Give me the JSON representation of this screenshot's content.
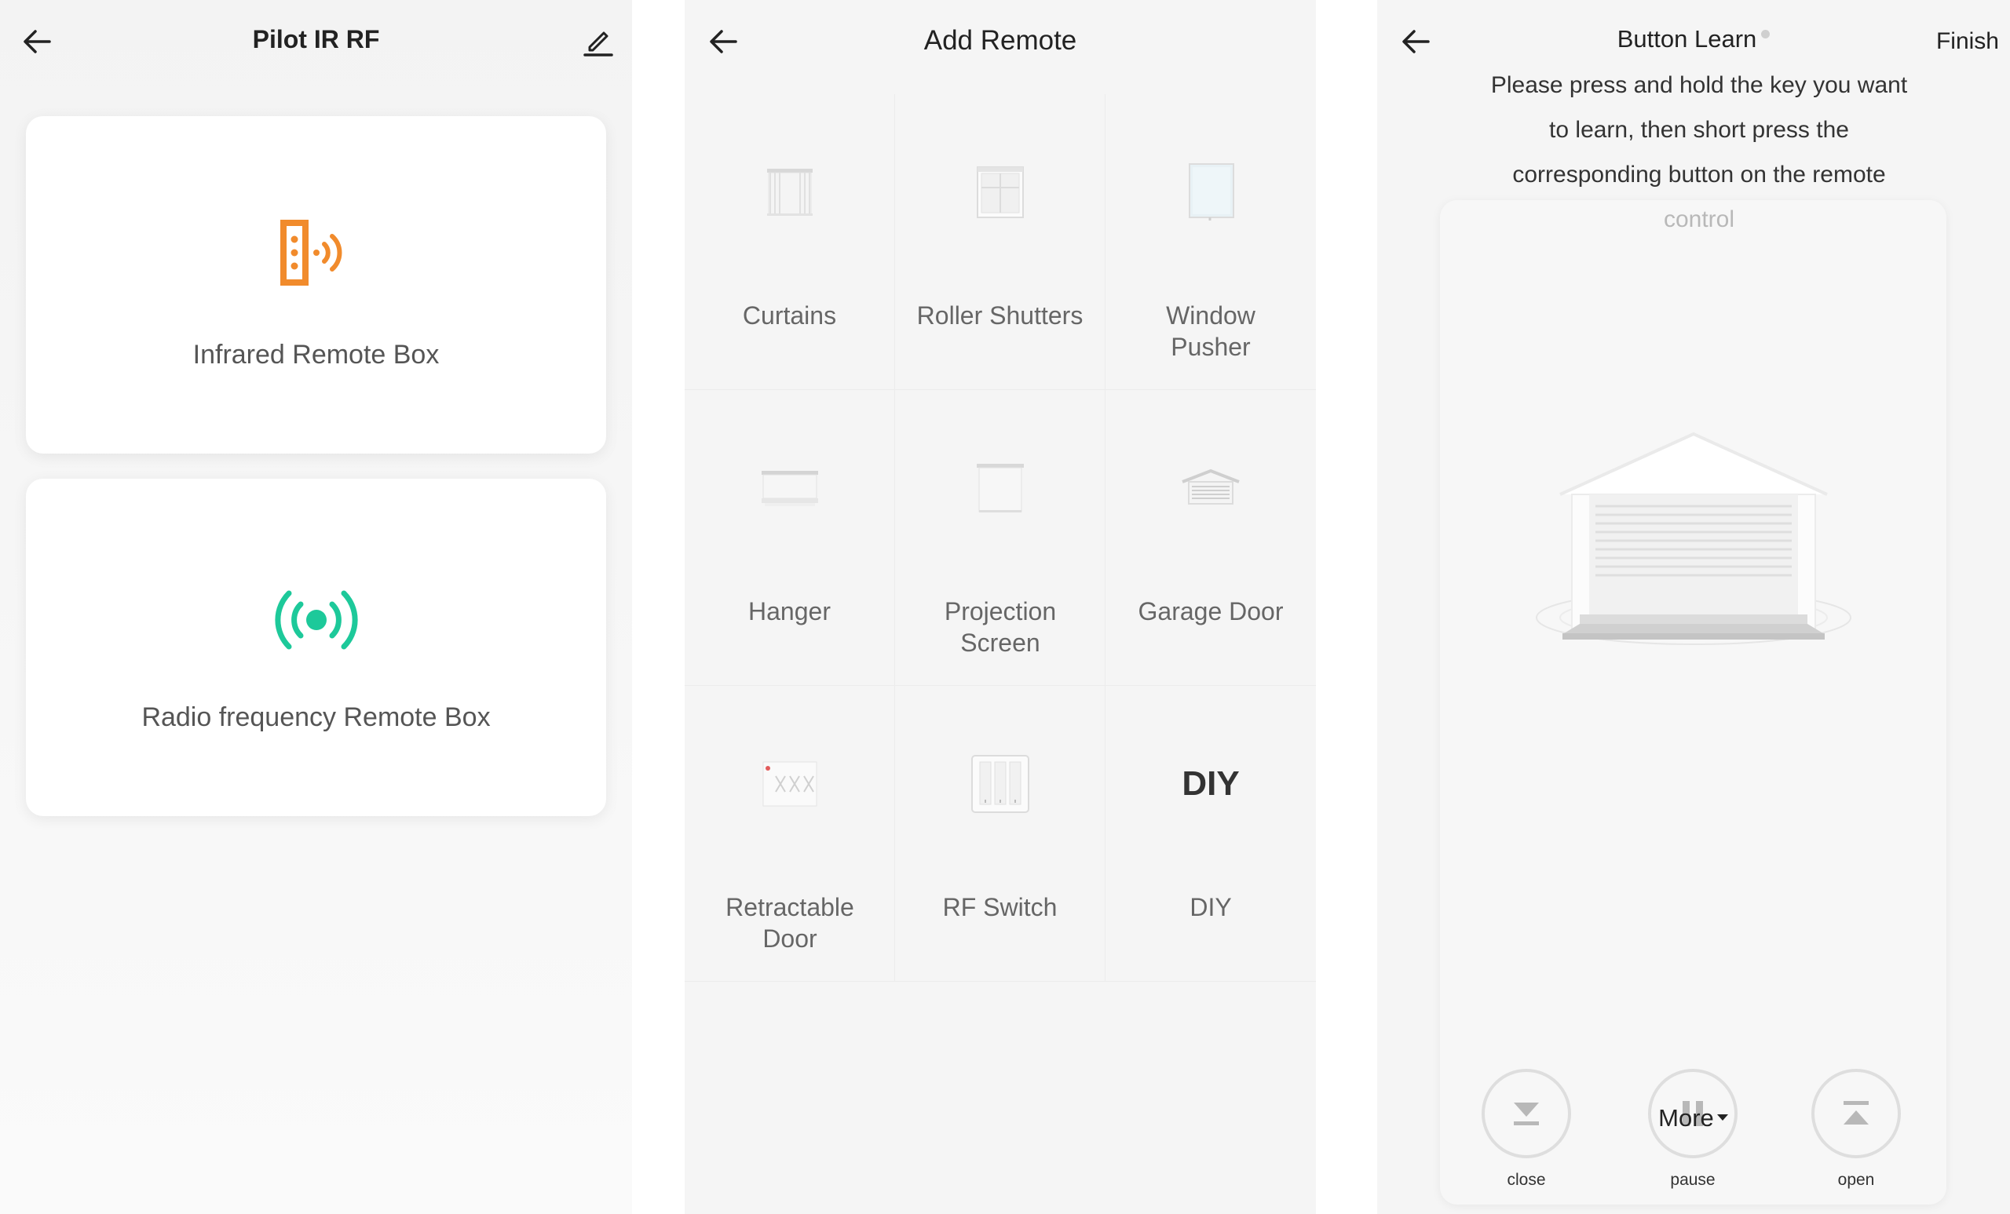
{
  "panel1": {
    "title": "Pilot IR RF",
    "cards": [
      {
        "label": "Infrared Remote Box",
        "icon": "infrared-remote-icon",
        "color": "#F18B2C"
      },
      {
        "label": "Radio frequency Remote Box",
        "icon": "radio-frequency-icon",
        "color": "#1DC99A"
      }
    ]
  },
  "panel2": {
    "title": "Add Remote",
    "items": [
      {
        "label": "Curtains",
        "icon": "curtains-icon"
      },
      {
        "label": "Roller Shutters",
        "icon": "roller-shutters-icon"
      },
      {
        "label": "Window Pusher",
        "icon": "window-pusher-icon"
      },
      {
        "label": "Hanger",
        "icon": "hanger-icon"
      },
      {
        "label": "Projection Screen",
        "icon": "projection-screen-icon"
      },
      {
        "label": "Garage Door",
        "icon": "garage-door-icon"
      },
      {
        "label": "Retractable Door",
        "icon": "retractable-door-icon"
      },
      {
        "label": "RF Switch",
        "icon": "rf-switch-icon"
      },
      {
        "label": "DIY",
        "icon": "diy-icon",
        "icon_text": "DIY"
      }
    ]
  },
  "panel3": {
    "title": "Button Learn",
    "finish_label": "Finish",
    "instruction": "Please press and hold the key you want to learn, then short press the corresponding button on the remote",
    "instruction_faded": "control",
    "controls": [
      {
        "label": "close",
        "icon": "close-down-icon"
      },
      {
        "label": "pause",
        "icon": "pause-icon"
      },
      {
        "label": "open",
        "icon": "open-up-icon"
      }
    ],
    "more_label": "More"
  }
}
